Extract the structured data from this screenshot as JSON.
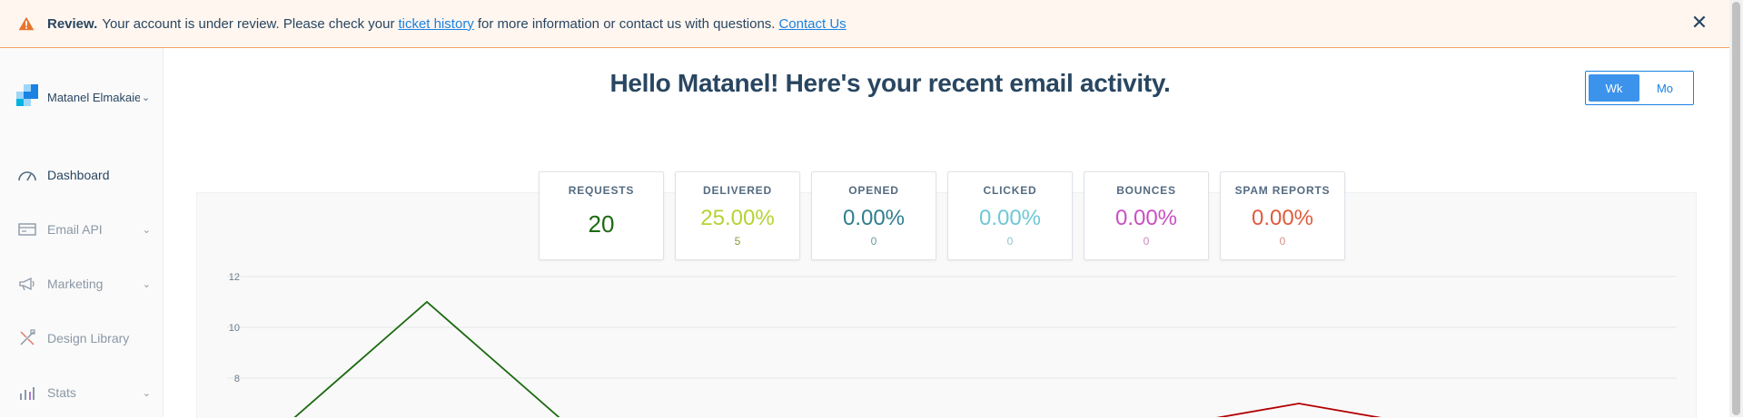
{
  "banner": {
    "title": "Review.",
    "text_before": "Your account is under review. Please check your",
    "link_history": "ticket history",
    "text_middle": "for more information or contact us with questions.",
    "link_contact": "Contact Us",
    "close_glyph": "✕",
    "warning_color": "#e7752d"
  },
  "sidebar": {
    "account_name": "Matanel Elmakaies",
    "items": [
      {
        "label": "Dashboard",
        "icon": "gauge-icon",
        "active": true
      },
      {
        "label": "Email API",
        "icon": "email-api-icon",
        "expandable": true
      },
      {
        "label": "Marketing",
        "icon": "megaphone-icon",
        "expandable": true
      },
      {
        "label": "Design Library",
        "icon": "design-tools-icon"
      },
      {
        "label": "Stats",
        "icon": "bar-chart-icon",
        "expandable": true
      }
    ]
  },
  "main": {
    "title": "Hello Matanel! Here's your recent email activity.",
    "toggle": {
      "week": "Wk",
      "month": "Mo",
      "selected": "Wk"
    }
  },
  "stats": [
    {
      "label": "REQUESTS",
      "value": "20",
      "sub": "",
      "color": "#1d6a12"
    },
    {
      "label": "DELIVERED",
      "value": "25.00%",
      "sub": "5",
      "color": "#b5d334"
    },
    {
      "label": "OPENED",
      "value": "0.00%",
      "sub": "0",
      "color": "#2f7e8f"
    },
    {
      "label": "CLICKED",
      "value": "0.00%",
      "sub": "0",
      "color": "#6fc8d6"
    },
    {
      "label": "BOUNCES",
      "value": "0.00%",
      "sub": "0",
      "color": "#c94fc2"
    },
    {
      "label": "SPAM REPORTS",
      "value": "0.00%",
      "sub": "0",
      "color": "#e05a3d"
    }
  ],
  "chart_data": {
    "type": "line",
    "y_ticks": [
      "12",
      "10",
      "8"
    ],
    "ylim": [
      6,
      12
    ],
    "grid": true,
    "series": [
      {
        "color": "#1d6a12",
        "points": [
          [
            0.0,
            6.0
          ],
          [
            0.1,
            11.0
          ],
          [
            0.2,
            6.0
          ]
        ]
      },
      {
        "color": "#b20000",
        "points": [
          [
            0.6,
            6.0
          ],
          [
            0.7,
            7.0
          ],
          [
            0.8,
            6.0
          ]
        ]
      }
    ]
  }
}
